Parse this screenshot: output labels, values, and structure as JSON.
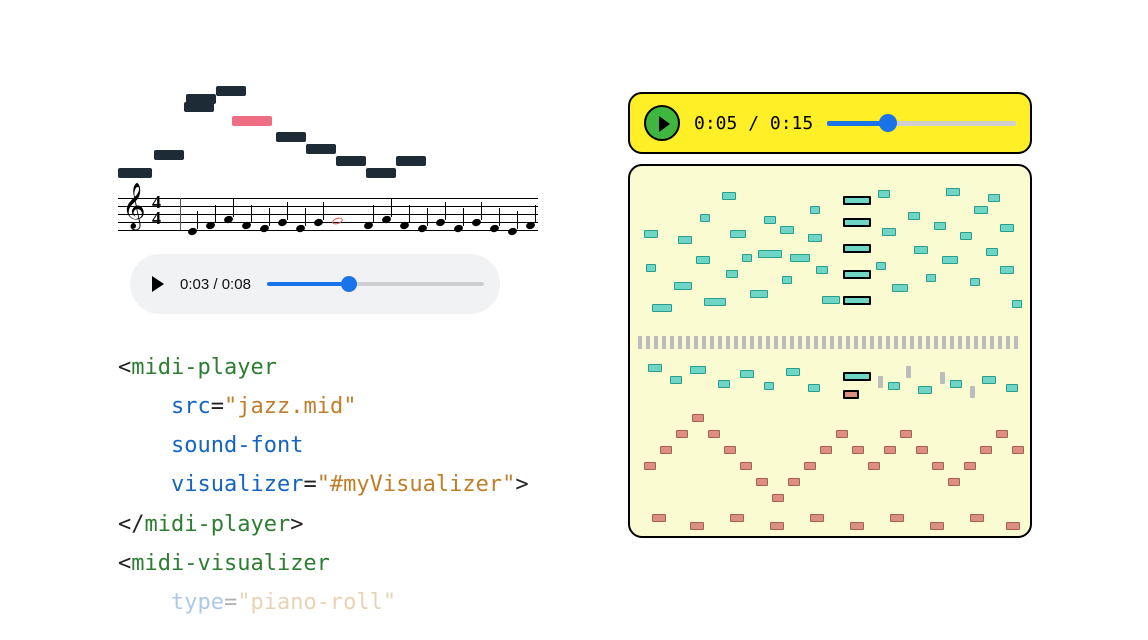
{
  "left": {
    "player": {
      "current": "0:03",
      "total": "0:08",
      "progress_pct": 38
    },
    "timesig_top": "4",
    "timesig_bot": "4",
    "code": {
      "l1_tag": "midi-player",
      "l2_attr": "src",
      "l2_val": "\"jazz.mid\"",
      "l3_attr": "sound-font",
      "l4_attr": "visualizer",
      "l4_val": "\"#myVisualizer\"",
      "l5_tag": "midi-player",
      "l6_tag": "midi-visualizer",
      "l7_attr": "type",
      "l7_val": "\"piano-roll\""
    }
  },
  "right": {
    "player": {
      "current": "0:05",
      "total": "0:15",
      "progress_pct": 32
    }
  }
}
